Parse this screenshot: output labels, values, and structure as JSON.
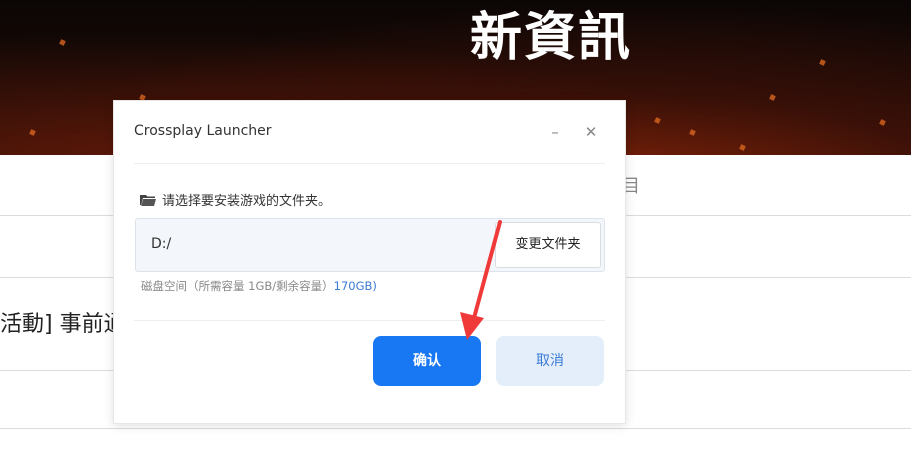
{
  "background": {
    "hero_title": "新資訊",
    "news_text": "活動] 事前通",
    "side_glyph": "目"
  },
  "dialog": {
    "title": "Crossplay Launcher",
    "minimize_label": "–",
    "close_label": "✕",
    "prompt": "请选择要安装游戏的文件夹。",
    "path": "D:/",
    "change_button": "变更文件夹",
    "disk_space_prefix": "磁盘空间（所需容量 1GB/剩余容量）",
    "disk_space_free": "170GB)",
    "confirm_button": "确认",
    "cancel_button": "取消"
  },
  "colors": {
    "primary": "#1877f2",
    "secondary_bg": "#e4eefb",
    "annotation_arrow": "#f03a3a"
  },
  "icons": [
    "folder-icon",
    "minimize-icon",
    "close-icon",
    "annotation-arrow"
  ]
}
